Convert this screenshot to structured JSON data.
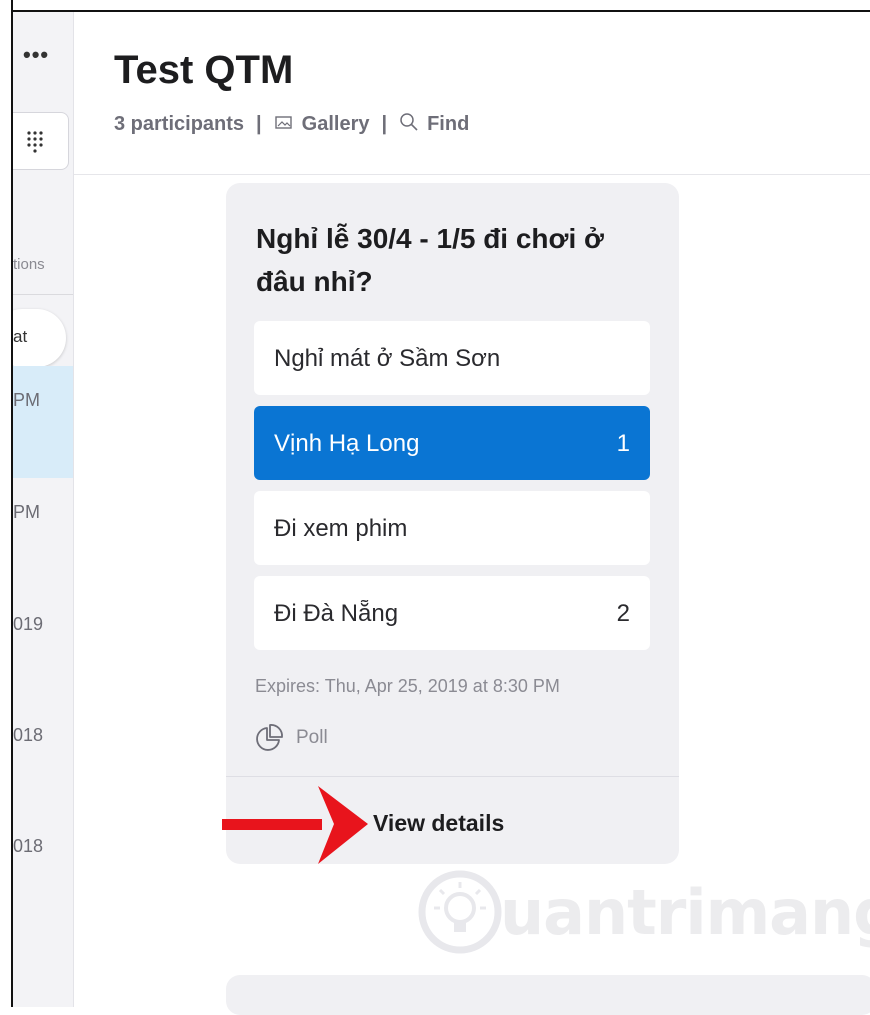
{
  "sidebar": {
    "more_glyph": "•••",
    "dialpad_icon": "dialpad-icon",
    "section_label": "tions",
    "chat_label": "at",
    "recents": [
      {
        "time": "PM",
        "active": true
      },
      {
        "time": "PM",
        "active": false
      },
      {
        "time": "019",
        "active": false
      },
      {
        "time": "018",
        "active": false
      },
      {
        "time": "018",
        "active": false
      }
    ]
  },
  "header": {
    "title": "Test QTM",
    "participants": "3 participants",
    "separator": "|",
    "gallery_label": "Gallery",
    "find_label": "Find"
  },
  "poll": {
    "question": "Nghỉ lễ 30/4 - 1/5 đi chơi ở đâu nhỉ?",
    "options": [
      {
        "label": "Nghỉ mát ở Sầm Sơn",
        "count": "",
        "selected": false
      },
      {
        "label": "Vịnh Hạ Long",
        "count": "1",
        "selected": true
      },
      {
        "label": "Đi xem phim",
        "count": "",
        "selected": false
      },
      {
        "label": "Đi Đà Nẵng",
        "count": "2",
        "selected": false
      }
    ],
    "expires": "Expires: Thu, Apr 25, 2019 at 8:30 PM",
    "type_label": "Poll",
    "view_details": "View details"
  },
  "watermark": {
    "text": "uantrimang"
  },
  "colors": {
    "accent": "#0a75d3",
    "card_bg": "#f0f0f3",
    "annotation_arrow": "#e8141c",
    "active_recent": "#d8ecf9"
  }
}
